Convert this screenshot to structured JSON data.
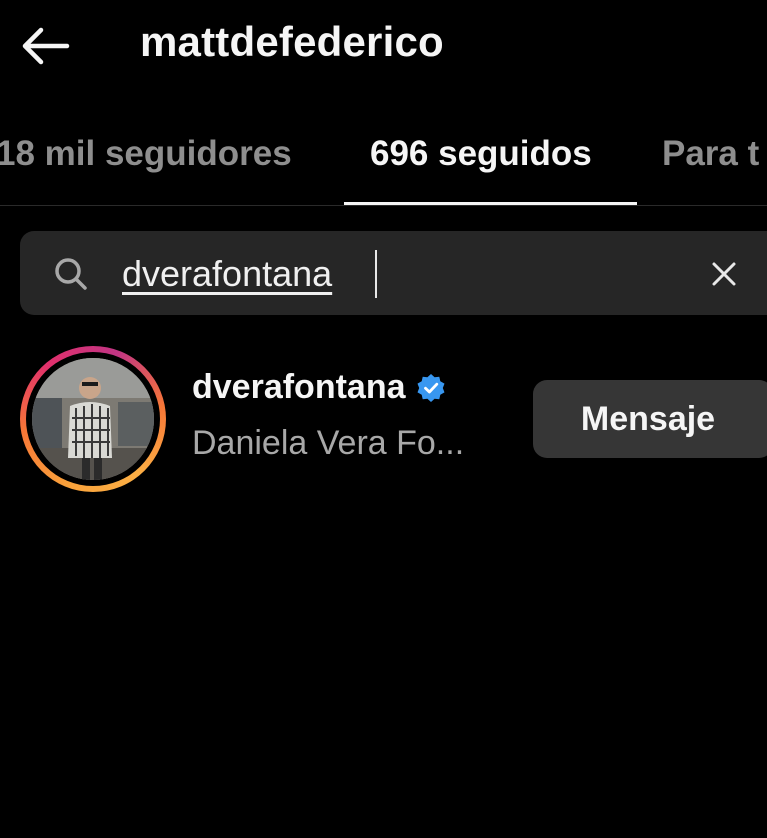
{
  "header": {
    "title": "mattdefederico",
    "back_icon": "arrow-left-icon"
  },
  "tabs": [
    {
      "label": "18 mil seguidores",
      "active": false
    },
    {
      "label": "696 seguidos",
      "active": true
    },
    {
      "label": "Para t",
      "active": false
    }
  ],
  "search": {
    "value": "dverafontana",
    "icon": "search-icon",
    "clear_icon": "close-icon"
  },
  "results": [
    {
      "username": "dverafontana",
      "verified": true,
      "full_name": "Daniela Vera Fo...",
      "action_label": "Mensaje"
    }
  ],
  "colors": {
    "background": "#000000",
    "search_bg": "#262626",
    "button_bg": "#363636",
    "verified_blue": "#3897f0",
    "inactive_tab": "#8e8e8e"
  }
}
